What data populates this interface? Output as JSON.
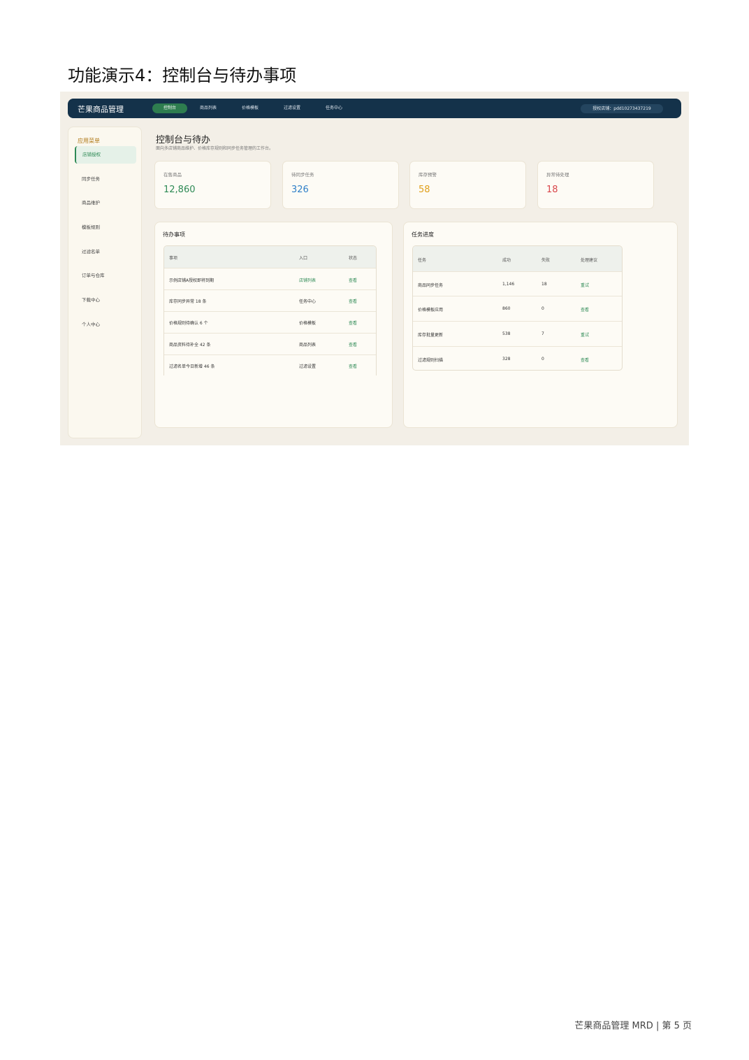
{
  "doc": {
    "title": "功能演示4：控制台与待办事项",
    "footer": "芒果商品管理 MRD | 第 5 页"
  },
  "app": {
    "brand": "芒果商品管理",
    "nav": [
      "控制台",
      "商品列表",
      "价格模板",
      "过滤设置",
      "任务中心"
    ],
    "shop": "授权店铺：pdd10273437219"
  },
  "sidebar": {
    "title": "应用菜单",
    "items": [
      "店铺授权",
      "同步任务",
      "商品维护",
      "模板规则",
      "过滤名单",
      "订单与仓库",
      "下载中心",
      "个人中心"
    ]
  },
  "page": {
    "title": "控制台与待办",
    "subtitle": "面向多店铺商品维护、价格库存规则和同步任务管理的工作台。"
  },
  "stats": [
    {
      "label": "在售商品",
      "value": "12,860",
      "color": "#2e8a55"
    },
    {
      "label": "待同步任务",
      "value": "326",
      "color": "#2f7fc8"
    },
    {
      "label": "库存预警",
      "value": "58",
      "color": "#e0a01c"
    },
    {
      "label": "异常待处理",
      "value": "18",
      "color": "#d9474b"
    }
  ],
  "todo": {
    "title": "待办事项",
    "headers": [
      "事项",
      "入口",
      "状态"
    ],
    "rows": [
      {
        "item": "示例店铺A授权即将到期",
        "entry": "店铺列表",
        "status": "查看"
      },
      {
        "item": "库存同步异常 18 条",
        "entry": "任务中心",
        "status": "查看"
      },
      {
        "item": "价格规则待确认 6 个",
        "entry": "价格模板",
        "status": "查看"
      },
      {
        "item": "商品资料待补全 42 条",
        "entry": "商品列表",
        "status": "查看"
      },
      {
        "item": "过滤名单今日新增 46 条",
        "entry": "过滤设置",
        "status": "查看"
      }
    ]
  },
  "progress": {
    "title": "任务进度",
    "headers": [
      "任务",
      "成功",
      "失败",
      "处理建议"
    ],
    "rows": [
      {
        "task": "商品同步任务",
        "success": "1,146",
        "fail": "18",
        "action": "重试"
      },
      {
        "task": "价格模板应用",
        "success": "860",
        "fail": "0",
        "action": "查看"
      },
      {
        "task": "库存批量更新",
        "success": "538",
        "fail": "7",
        "action": "重试"
      },
      {
        "task": "过滤规则扫描",
        "success": "328",
        "fail": "0",
        "action": "查看"
      }
    ]
  }
}
